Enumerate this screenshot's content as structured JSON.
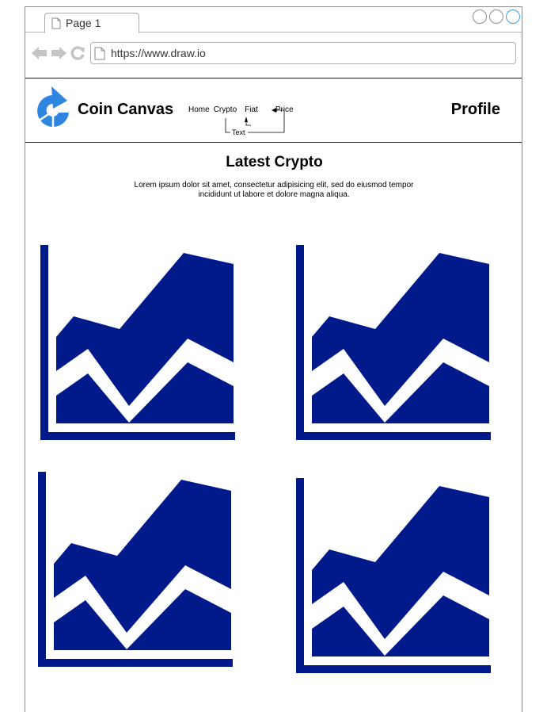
{
  "browser": {
    "tab_label": "Page 1",
    "url": "https://www.draw.io",
    "icons": [
      "page-icon",
      "back-arrow-icon",
      "forward-arrow-icon",
      "refresh-icon"
    ]
  },
  "header": {
    "brand": "Coin Canvas",
    "menu": [
      "Home",
      "Crypto",
      "Fiat",
      "Price"
    ],
    "annotation": "Text",
    "profile": "Profile",
    "logo_color": "#2f86e0"
  },
  "main": {
    "title": "Latest Crypto",
    "description": "Lorem ipsum dolor sit amet, consectetur adipisicing elit, sed do eiusmod tempor incididunt ut labore et dolore magna aliqua."
  },
  "charts": {
    "count": 4,
    "icon": "area-chart-icon",
    "color": "#001a8c"
  }
}
